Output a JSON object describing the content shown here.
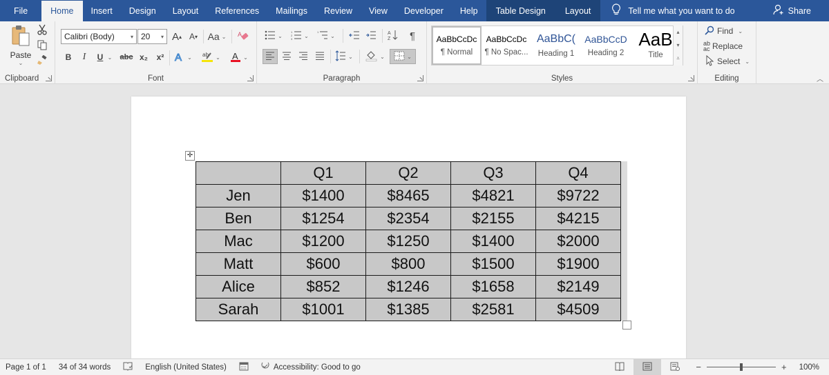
{
  "tabs": {
    "items": [
      {
        "label": "File"
      },
      {
        "label": "Home"
      },
      {
        "label": "Insert"
      },
      {
        "label": "Design"
      },
      {
        "label": "Layout"
      },
      {
        "label": "References"
      },
      {
        "label": "Mailings"
      },
      {
        "label": "Review"
      },
      {
        "label": "View"
      },
      {
        "label": "Developer"
      },
      {
        "label": "Help"
      }
    ],
    "active": "Home",
    "contextual": [
      {
        "label": "Table Design"
      },
      {
        "label": "Layout"
      }
    ],
    "tell_me": "Tell me what you want to do",
    "share": "Share"
  },
  "ribbon": {
    "clipboard": {
      "label": "Clipboard",
      "paste": "Paste"
    },
    "font": {
      "label": "Font",
      "font_name": "Calibri (Body)",
      "font_size": "20",
      "bold": "B",
      "italic": "I",
      "underline": "U",
      "strike": "abc",
      "subscript": "x₂",
      "superscript": "x²",
      "change_case": "Aa",
      "grow": "A",
      "shrink": "A",
      "highlight_color": "#f5e50a",
      "font_color": "#e81123"
    },
    "paragraph": {
      "label": "Paragraph"
    },
    "styles": {
      "label": "Styles",
      "items": [
        {
          "preview": "AaBbCcDc",
          "name": "¶ Normal"
        },
        {
          "preview": "AaBbCcDc",
          "name": "¶ No Spac..."
        },
        {
          "preview": "AaBbC(",
          "name": "Heading 1"
        },
        {
          "preview": "AaBbCcD",
          "name": "Heading 2"
        },
        {
          "preview": "AaB",
          "name": "Title"
        }
      ]
    },
    "editing": {
      "label": "Editing",
      "find": "Find",
      "replace": "Replace",
      "select": "Select"
    }
  },
  "table": {
    "header": [
      "",
      "Q1",
      "Q2",
      "Q3",
      "Q4"
    ],
    "rows": [
      [
        "Jen",
        "$1400",
        "$8465",
        "$4821",
        "$9722"
      ],
      [
        "Ben",
        "$1254",
        "$2354",
        "$2155",
        "$4215"
      ],
      [
        "Mac",
        "$1200",
        "$1250",
        "$1400",
        "$2000"
      ],
      [
        "Matt",
        "$600",
        "$800",
        "$1500",
        "$1900"
      ],
      [
        "Alice",
        "$852",
        "$1246",
        "$1658",
        "$2149"
      ],
      [
        "Sarah",
        "$1001",
        "$1385",
        "$2581",
        "$4509"
      ]
    ]
  },
  "status": {
    "page": "Page 1 of 1",
    "words": "34 of 34 words",
    "language": "English (United States)",
    "accessibility": "Accessibility: Good to go",
    "zoom_percent": "100%",
    "zoom_minus": "−",
    "zoom_plus": "+"
  },
  "colors": {
    "brand": "#2b579a",
    "table_fill": "#c8c8c8"
  }
}
